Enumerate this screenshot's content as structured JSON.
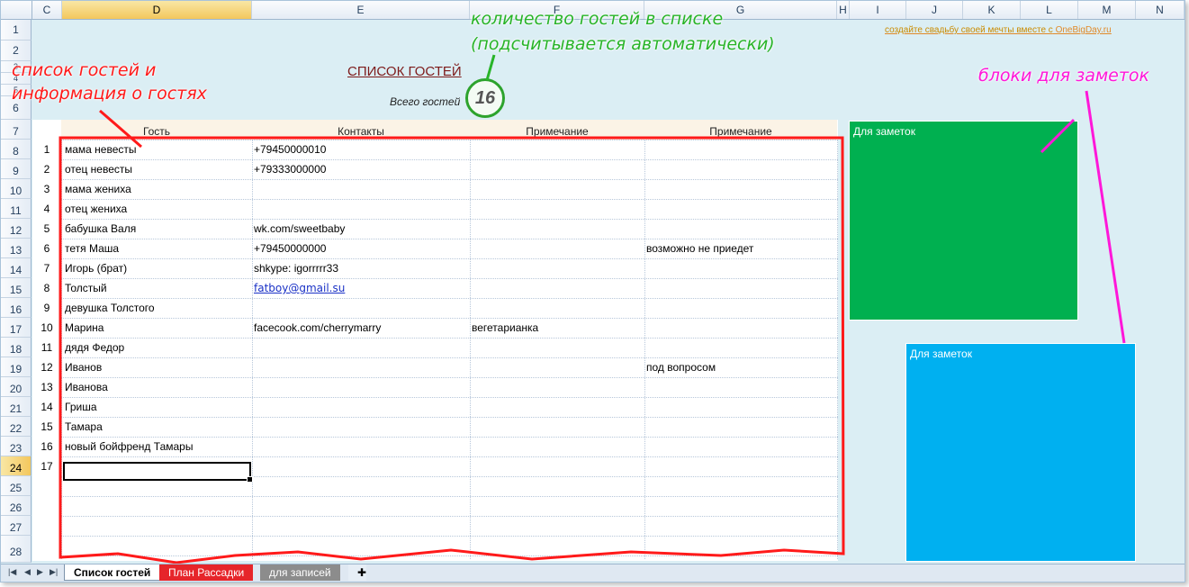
{
  "columns": [
    "C",
    "D",
    "E",
    "F",
    "G",
    "H",
    "I",
    "J",
    "K",
    "L",
    "M",
    "N"
  ],
  "active_column": "D",
  "rows": [
    "1",
    "2",
    "3",
    "4",
    "5",
    "6",
    "7",
    "8",
    "9",
    "10",
    "11",
    "12",
    "13",
    "14",
    "15",
    "16",
    "17",
    "18",
    "19",
    "20",
    "21",
    "22",
    "23",
    "24",
    "25",
    "26",
    "27",
    "28"
  ],
  "active_row": "24",
  "sheet": {
    "title": "СПИСОК ГОСТЕЙ",
    "total_label": "Всего гостей",
    "total_count": "16",
    "promo_text": "создайте свадьбу своей мечты вместе с",
    "promo_link": "OneBigDay.ru"
  },
  "table": {
    "headers": [
      "Гость",
      "Контакты",
      "Примечание",
      "Примечание"
    ],
    "rows": [
      {
        "n": "1",
        "guest": "мама невесты",
        "contact": "+79450000010",
        "note1": "",
        "note2": ""
      },
      {
        "n": "2",
        "guest": "отец невесты",
        "contact": "+79333000000",
        "note1": "",
        "note2": ""
      },
      {
        "n": "3",
        "guest": "мама жениха",
        "contact": "",
        "note1": "",
        "note2": ""
      },
      {
        "n": "4",
        "guest": "отец жениха",
        "contact": "",
        "note1": "",
        "note2": ""
      },
      {
        "n": "5",
        "guest": "бабушка Валя",
        "contact": "wk.com/sweetbaby",
        "note1": "",
        "note2": ""
      },
      {
        "n": "6",
        "guest": "тетя Маша",
        "contact": "+79450000000",
        "note1": "",
        "note2": "возможно не приедет"
      },
      {
        "n": "7",
        "guest": "Игорь (брат)",
        "contact": "shkype: igorrrrr33",
        "note1": "",
        "note2": ""
      },
      {
        "n": "8",
        "guest": "Толстый",
        "contact": "fatboy@gmail.su",
        "note1": "",
        "note2": ""
      },
      {
        "n": "9",
        "guest": "девушка Толстого",
        "contact": "",
        "note1": "",
        "note2": ""
      },
      {
        "n": "10",
        "guest": "Марина",
        "contact": "facecook.com/cherrymarry",
        "note1": "вегетарианка",
        "note2": ""
      },
      {
        "n": "11",
        "guest": "дядя Федор",
        "contact": "",
        "note1": "",
        "note2": ""
      },
      {
        "n": "12",
        "guest": "Иванов",
        "contact": "",
        "note1": "",
        "note2": "под вопросом"
      },
      {
        "n": "13",
        "guest": "Иванова",
        "contact": "",
        "note1": "",
        "note2": ""
      },
      {
        "n": "14",
        "guest": "Гриша",
        "contact": "",
        "note1": "",
        "note2": ""
      },
      {
        "n": "15",
        "guest": "Тамара",
        "contact": "",
        "note1": "",
        "note2": ""
      },
      {
        "n": "16",
        "guest": "новый бойфренд Тамары",
        "contact": "",
        "note1": "",
        "note2": ""
      },
      {
        "n": "17",
        "guest": "",
        "contact": "",
        "note1": "",
        "note2": ""
      }
    ]
  },
  "notes": {
    "green_label": "Для заметок",
    "blue_label": "Для заметок"
  },
  "annotations": {
    "guest_list_line1": "список гостей и",
    "guest_list_line2": "информация о гостях",
    "count_line1": "количество гостей в списке",
    "count_line2": "(подсчитывается автоматически)",
    "notes_blocks": "блоки для заметок"
  },
  "tabs": [
    "Список гостей",
    "План Рассадки",
    "для записей"
  ],
  "colors": {
    "accent_red": "#ff1a1a",
    "accent_green": "#28b428",
    "accent_pink": "#ff17d9",
    "note_green": "#00b050",
    "note_blue": "#00b0f0"
  }
}
